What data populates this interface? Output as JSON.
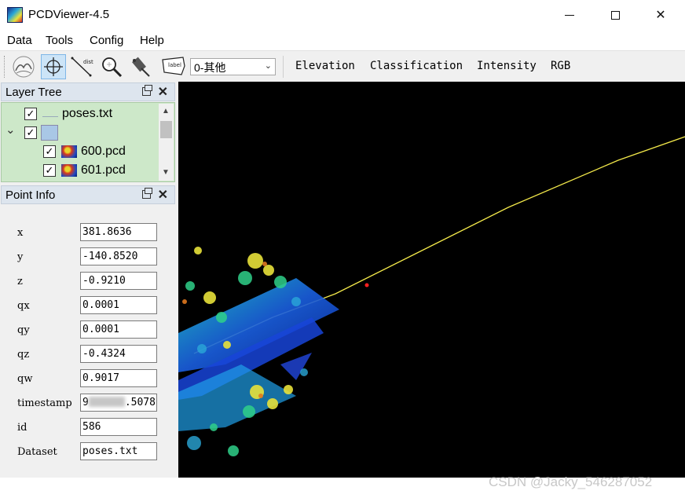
{
  "window": {
    "title": "PCDViewer-4.5",
    "close_glyph": "✕"
  },
  "menu": [
    "Data",
    "Tools",
    "Config",
    "Help"
  ],
  "toolbar": {
    "tools": [
      {
        "icon": "point-cloud-icon"
      },
      {
        "icon": "crosshair-select-icon",
        "active": true
      },
      {
        "icon": "measure-distance-icon",
        "text": "dist"
      },
      {
        "icon": "zoom-icon"
      },
      {
        "icon": "eraser-icon"
      },
      {
        "icon": "label-tag-icon",
        "text": "label"
      }
    ],
    "label_select_value": "0-其他",
    "color_modes": [
      "Elevation",
      "Classification",
      "Intensity",
      "RGB"
    ]
  },
  "layer_tree": {
    "title": "Layer Tree",
    "items": [
      {
        "label": "poses.txt",
        "checked": true,
        "icon": "pose-trajectory-icon"
      },
      {
        "label": "",
        "checked": true,
        "icon": "folder-icon",
        "expanded": true
      },
      {
        "label": "600.pcd",
        "checked": true,
        "icon": "point-cloud-thumb-icon"
      },
      {
        "label": "601.pcd",
        "checked": true,
        "icon": "point-cloud-thumb-icon"
      }
    ]
  },
  "point_info": {
    "title": "Point Info",
    "fields": [
      {
        "label": "x",
        "value": "381.8636"
      },
      {
        "label": "y",
        "value": "-140.8520"
      },
      {
        "label": "z",
        "value": "-0.9210"
      },
      {
        "label": "qx",
        "value": "0.0001"
      },
      {
        "label": "qy",
        "value": "0.0001"
      },
      {
        "label": "qz",
        "value": "-0.4324"
      },
      {
        "label": "qw",
        "value": "0.9017"
      },
      {
        "label": "timestamp",
        "value_prefix": "9",
        "value_suffix": ".5078"
      },
      {
        "label": "id",
        "value": "586"
      },
      {
        "label": "Dataset",
        "value": "poses.txt"
      }
    ]
  },
  "panel_glyphs": {
    "close": "✕",
    "checkmark": "✓",
    "expand": "⌄",
    "scroll_up": "▲",
    "scroll_down": "▼",
    "dropdown": "⌄"
  },
  "watermark": "CSDN @Jacky_546287052",
  "colors": {
    "viewport_bg": "#000000",
    "layer_tree_bg": "#cde8c9",
    "selected_point": "#ff2020",
    "trajectory": "#f2e84a"
  }
}
